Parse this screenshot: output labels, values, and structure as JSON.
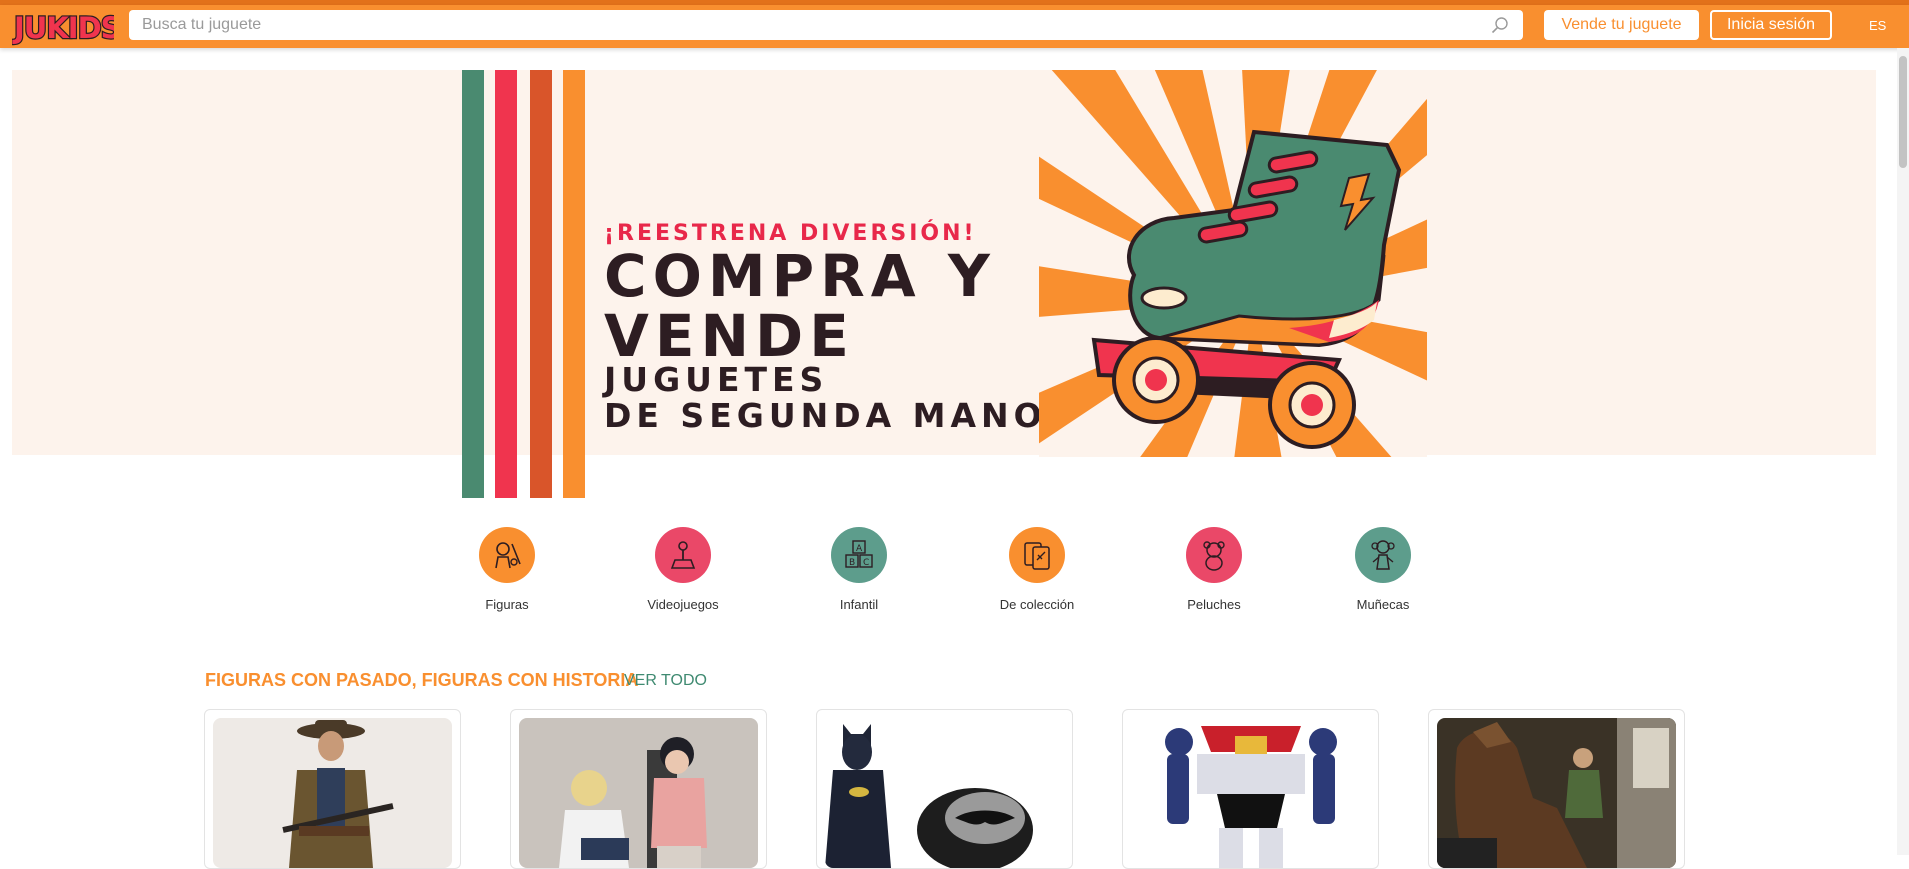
{
  "header": {
    "logo_text": "JUKIDS",
    "search_placeholder": "Busca tu juguete",
    "sell_button": "Vende tu juguete",
    "login_button": "Inicia sesión",
    "language": "ES"
  },
  "hero": {
    "tagline": "¡REESTRENA DIVERSIÓN!",
    "headline": "COMPRA Y VENDE",
    "subline_1": "JUGUETES",
    "subline_2": "DE SEGUNDA MANO",
    "stripe_colors": [
      "#4a8a70",
      "#f0344e",
      "#d9552a",
      "#f98f2f"
    ]
  },
  "categories": [
    {
      "label": "Figuras",
      "icon": "figures-icon",
      "color": "#f98f2f"
    },
    {
      "label": "Videojuegos",
      "icon": "joystick-icon",
      "color": "#ea4868"
    },
    {
      "label": "Infantil",
      "icon": "abc-blocks-icon",
      "color": "#5d9d8c"
    },
    {
      "label": "De colección",
      "icon": "collectible-cards-icon",
      "color": "#f98f2f"
    },
    {
      "label": "Peluches",
      "icon": "teddy-bear-icon",
      "color": "#ea4868"
    },
    {
      "label": "Muñecas",
      "icon": "doll-icon",
      "color": "#5d9d8c"
    }
  ],
  "section": {
    "title": "FIGURAS CON PASADO, FIGURAS CON HISTORIA",
    "see_all": "VER TODO",
    "products": [
      {
        "name": "cowboy-figure"
      },
      {
        "name": "anime-figures"
      },
      {
        "name": "batman-figure"
      },
      {
        "name": "mazinger-robot-figure"
      },
      {
        "name": "horse-rider-figure"
      }
    ]
  },
  "colors": {
    "brand_orange": "#f98f2f",
    "brand_red": "#ea4868",
    "brand_teal": "#5d9d8c",
    "hero_bg": "#fdf3ec"
  }
}
